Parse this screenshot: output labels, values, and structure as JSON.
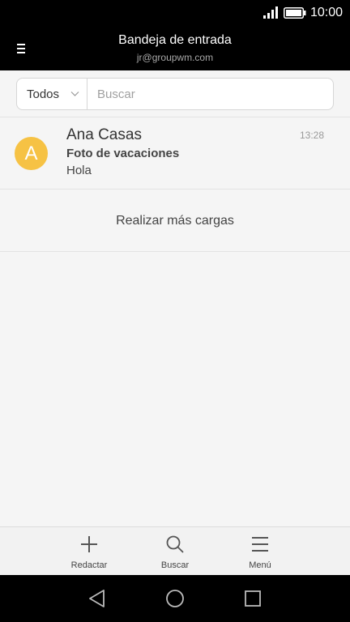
{
  "status_bar": {
    "time": "10:00",
    "icons": [
      "signal-icon",
      "battery-icon"
    ]
  },
  "header": {
    "title": "Bandeja de entrada",
    "account": "jr@groupwm.com",
    "menu_icon": "hamburger-menu-icon"
  },
  "search": {
    "filter_label": "Todos",
    "placeholder": "Buscar"
  },
  "messages": [
    {
      "avatar_letter": "A",
      "avatar_color": "#f6c244",
      "sender": "Ana Casas",
      "time": "13:28",
      "subject": "Foto de vacaciones",
      "preview": "Hola"
    }
  ],
  "load_more_label": "Realizar más cargas",
  "bottom_actions": [
    {
      "label": "Redactar",
      "icon": "plus-icon"
    },
    {
      "label": "Buscar",
      "icon": "search-icon"
    },
    {
      "label": "Menú",
      "icon": "menu-icon"
    }
  ],
  "nav_bar": [
    "back-icon",
    "home-icon",
    "recents-icon"
  ]
}
